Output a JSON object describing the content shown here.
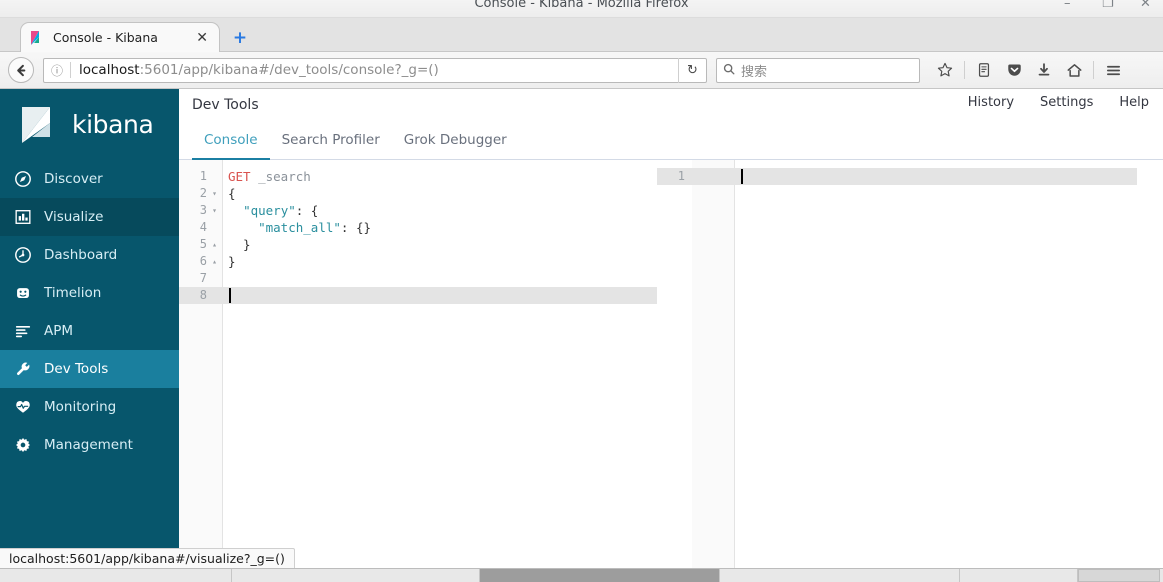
{
  "window": {
    "title": "Console - Kibana - Mozilla Firefox",
    "minimize_label": "–",
    "maximize_label": "❐",
    "close_label": "✕"
  },
  "browser": {
    "tab": {
      "title": "Console - Kibana",
      "close_label": "✕",
      "favicon_name": "kibana-favicon"
    },
    "new_tab_label": "+",
    "back_label": "←",
    "identity_label": "ⓘ",
    "url_bold": "localhost",
    "url_rest": ":5601/app/kibana#/dev_tools/console?_g=()",
    "url_full": "localhost:5601/app/kibana#/dev_tools/console?_g=()",
    "reload_label": "↻",
    "search": {
      "placeholder": "搜索",
      "icon_label": "⚲"
    },
    "toolbar_icons": [
      {
        "name": "bookmark-star-icon",
        "glyph": "☆"
      },
      {
        "name": "library-icon",
        "glyph": "☰"
      },
      {
        "name": "pocket-icon",
        "glyph": "⬤"
      },
      {
        "name": "downloads-icon",
        "glyph": "⬇"
      },
      {
        "name": "home-icon",
        "glyph": "⌂"
      },
      {
        "name": "menu-hamburger-icon",
        "glyph": "☰"
      }
    ]
  },
  "sidebar": {
    "logo_text": "kibana",
    "items": [
      {
        "label": "Discover",
        "icon": "compass-icon",
        "state": "normal"
      },
      {
        "label": "Visualize",
        "icon": "bar-chart-icon",
        "state": "hover"
      },
      {
        "label": "Dashboard",
        "icon": "dashboard-icon",
        "state": "normal"
      },
      {
        "label": "Timelion",
        "icon": "timelion-icon",
        "state": "normal"
      },
      {
        "label": "APM",
        "icon": "apm-icon",
        "state": "normal"
      },
      {
        "label": "Dev Tools",
        "icon": "wrench-icon",
        "state": "active"
      },
      {
        "label": "Monitoring",
        "icon": "heartbeat-icon",
        "state": "normal"
      },
      {
        "label": "Management",
        "icon": "gear-icon",
        "state": "normal"
      }
    ],
    "bg_color": "#07566c",
    "active_color": "#1a7f9e"
  },
  "kibana_header": {
    "title": "Dev Tools",
    "links": [
      {
        "label": "History"
      },
      {
        "label": "Settings"
      },
      {
        "label": "Help"
      }
    ]
  },
  "tabs": [
    {
      "label": "Console",
      "active": true
    },
    {
      "label": "Search Profiler",
      "active": false
    },
    {
      "label": "Grok Debugger",
      "active": false
    }
  ],
  "editor": {
    "accent_color": "#1b7fa3",
    "active_line": 8,
    "lines": [
      {
        "num": "1",
        "fold": "",
        "segments": [
          {
            "text": "GET",
            "cls": "tok-method"
          },
          {
            "text": " ",
            "cls": "tok-punct"
          },
          {
            "text": "_search",
            "cls": "tok-path"
          }
        ]
      },
      {
        "num": "2",
        "fold": "▾",
        "segments": [
          {
            "text": "{",
            "cls": "tok-punct"
          }
        ]
      },
      {
        "num": "3",
        "fold": "▾",
        "segments": [
          {
            "text": "  ",
            "cls": "tok-punct"
          },
          {
            "text": "\"query\"",
            "cls": "tok-key"
          },
          {
            "text": ": {",
            "cls": "tok-punct"
          }
        ]
      },
      {
        "num": "4",
        "fold": "",
        "segments": [
          {
            "text": "    ",
            "cls": "tok-punct"
          },
          {
            "text": "\"match_all\"",
            "cls": "tok-key"
          },
          {
            "text": ": {}",
            "cls": "tok-punct"
          }
        ]
      },
      {
        "num": "5",
        "fold": "▴",
        "segments": [
          {
            "text": "  }",
            "cls": "tok-punct"
          }
        ]
      },
      {
        "num": "6",
        "fold": "▴",
        "segments": [
          {
            "text": "}",
            "cls": "tok-punct"
          }
        ]
      },
      {
        "num": "7",
        "fold": "",
        "segments": []
      },
      {
        "num": "8",
        "fold": "",
        "segments": []
      }
    ]
  },
  "response": {
    "lines": [
      {
        "num": "1",
        "segments": []
      }
    ],
    "active_line": 1
  },
  "divider": {
    "handle_name": "pane-resize-handle"
  },
  "statusbar": {
    "link_preview": "localhost:5601/app/kibana#/visualize?_g=()"
  }
}
